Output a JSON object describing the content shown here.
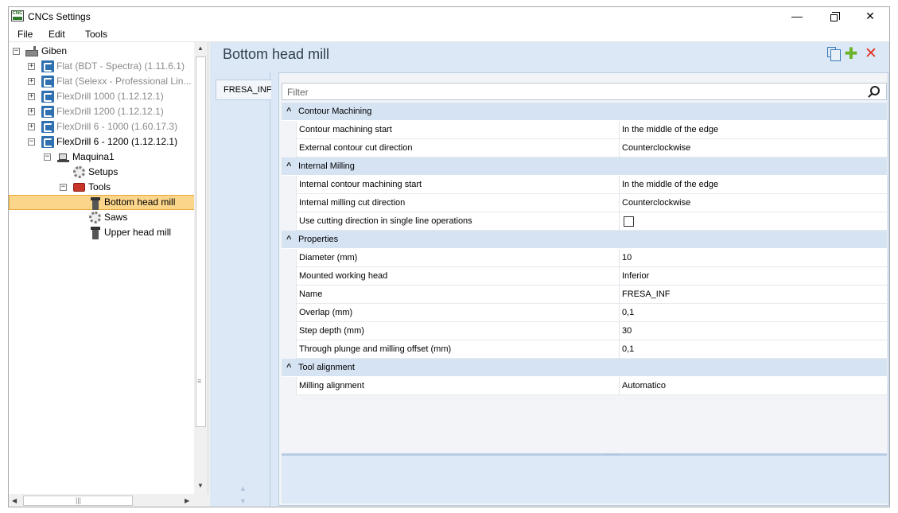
{
  "window": {
    "title": "CNCs Settings",
    "icon_text": "CNC",
    "controls": {
      "minimize": "—",
      "close": "✕"
    }
  },
  "menu": [
    "File",
    "Edit",
    "Tools"
  ],
  "tree": {
    "root": "Giben",
    "machines": [
      "Flat (BDT - Spectra) (1.11.6.1)",
      "Flat (Selexx - Professional Lin...",
      "FlexDrill 1000 (1.12.12.1)",
      "FlexDrill 1200 (1.12.12.1)",
      "FlexDrill 6 - 1000 (1.60.17.3)",
      "FlexDrill 6 - 1200 (1.12.12.1)"
    ],
    "machine_node": "Maquina1",
    "setups": "Setups",
    "tools": "Tools",
    "tool_items": [
      "Bottom head mill",
      "Saws",
      "Upper head mill"
    ]
  },
  "content": {
    "title": "Bottom head mill",
    "record_tab": "FRESA_INF",
    "filter_placeholder": "Filter",
    "categories": [
      {
        "label": "Contour Machining",
        "rows": [
          {
            "name": "Contour machining start",
            "value": "In the middle of the edge"
          },
          {
            "name": "External contour cut direction",
            "value": "Counterclockwise"
          }
        ]
      },
      {
        "label": "Internal Milling",
        "rows": [
          {
            "name": "Internal contour machining start",
            "value": "In the middle of the edge"
          },
          {
            "name": "Internal milling cut direction",
            "value": "Counterclockwise"
          },
          {
            "name": "Use cutting direction in single line operations",
            "checked": false
          }
        ]
      },
      {
        "label": "Properties",
        "rows": [
          {
            "name": "Diameter (mm)",
            "value": "10"
          },
          {
            "name": "Mounted working head",
            "value": "Inferior"
          },
          {
            "name": "Name",
            "value": "FRESA_INF"
          },
          {
            "name": "Overlap (mm)",
            "value": "0,1"
          },
          {
            "name": "Step depth (mm)",
            "value": "30"
          },
          {
            "name": "Through plunge and milling offset (mm)",
            "value": "0,1"
          }
        ]
      },
      {
        "label": "Tool alignment",
        "rows": [
          {
            "name": "Milling alignment",
            "value": "Automatico"
          }
        ]
      }
    ]
  },
  "colors": {
    "accent_blue": "#2f70b0",
    "selection": "#fbd58a",
    "category_bg": "#d5e3f3",
    "add_green": "#6cb52a",
    "delete_red": "#e2342b"
  },
  "icons": [
    "cnc-app-icon",
    "factory-icon",
    "machine-group-icon",
    "machine-icon",
    "gear-icon",
    "toolbox-icon",
    "mill-icon",
    "copy-icon",
    "add-icon",
    "delete-icon",
    "search-icon"
  ]
}
